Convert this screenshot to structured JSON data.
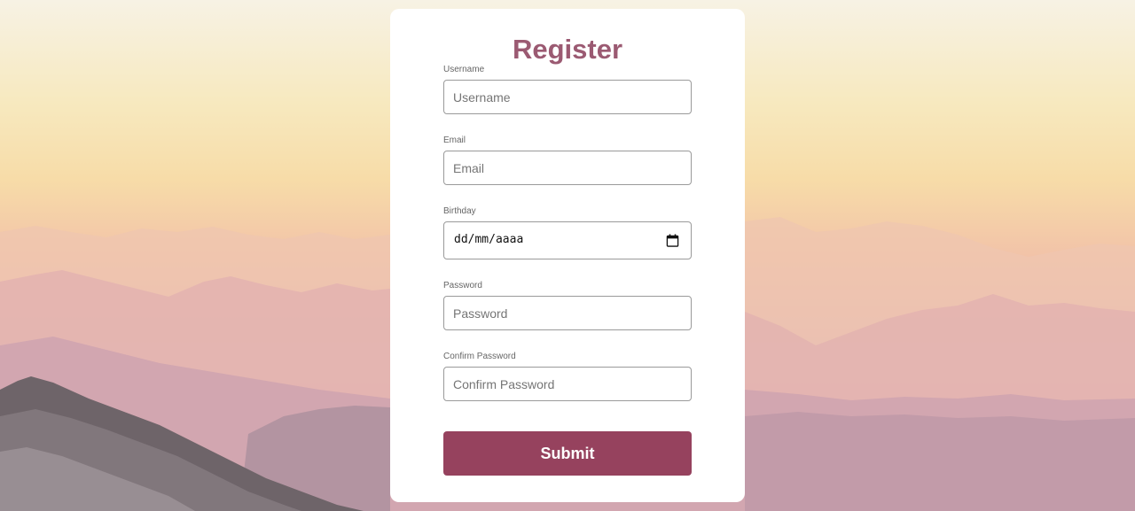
{
  "form": {
    "title": "Register",
    "fields": [
      {
        "label": "Username",
        "placeholder": "Username",
        "value": ""
      },
      {
        "label": "Email",
        "placeholder": "Email",
        "value": ""
      },
      {
        "label": "Birthday",
        "display": "dd/mm/aaaa"
      },
      {
        "label": "Password",
        "placeholder": "Password",
        "value": ""
      },
      {
        "label": "Confirm Password",
        "placeholder": "Confirm Password",
        "value": ""
      }
    ],
    "submit_label": "Submit"
  },
  "colors": {
    "title": "#9b5a72",
    "button": "#96425e",
    "card": "#ffffff"
  },
  "icons": {
    "birthday": "calendar-icon"
  }
}
